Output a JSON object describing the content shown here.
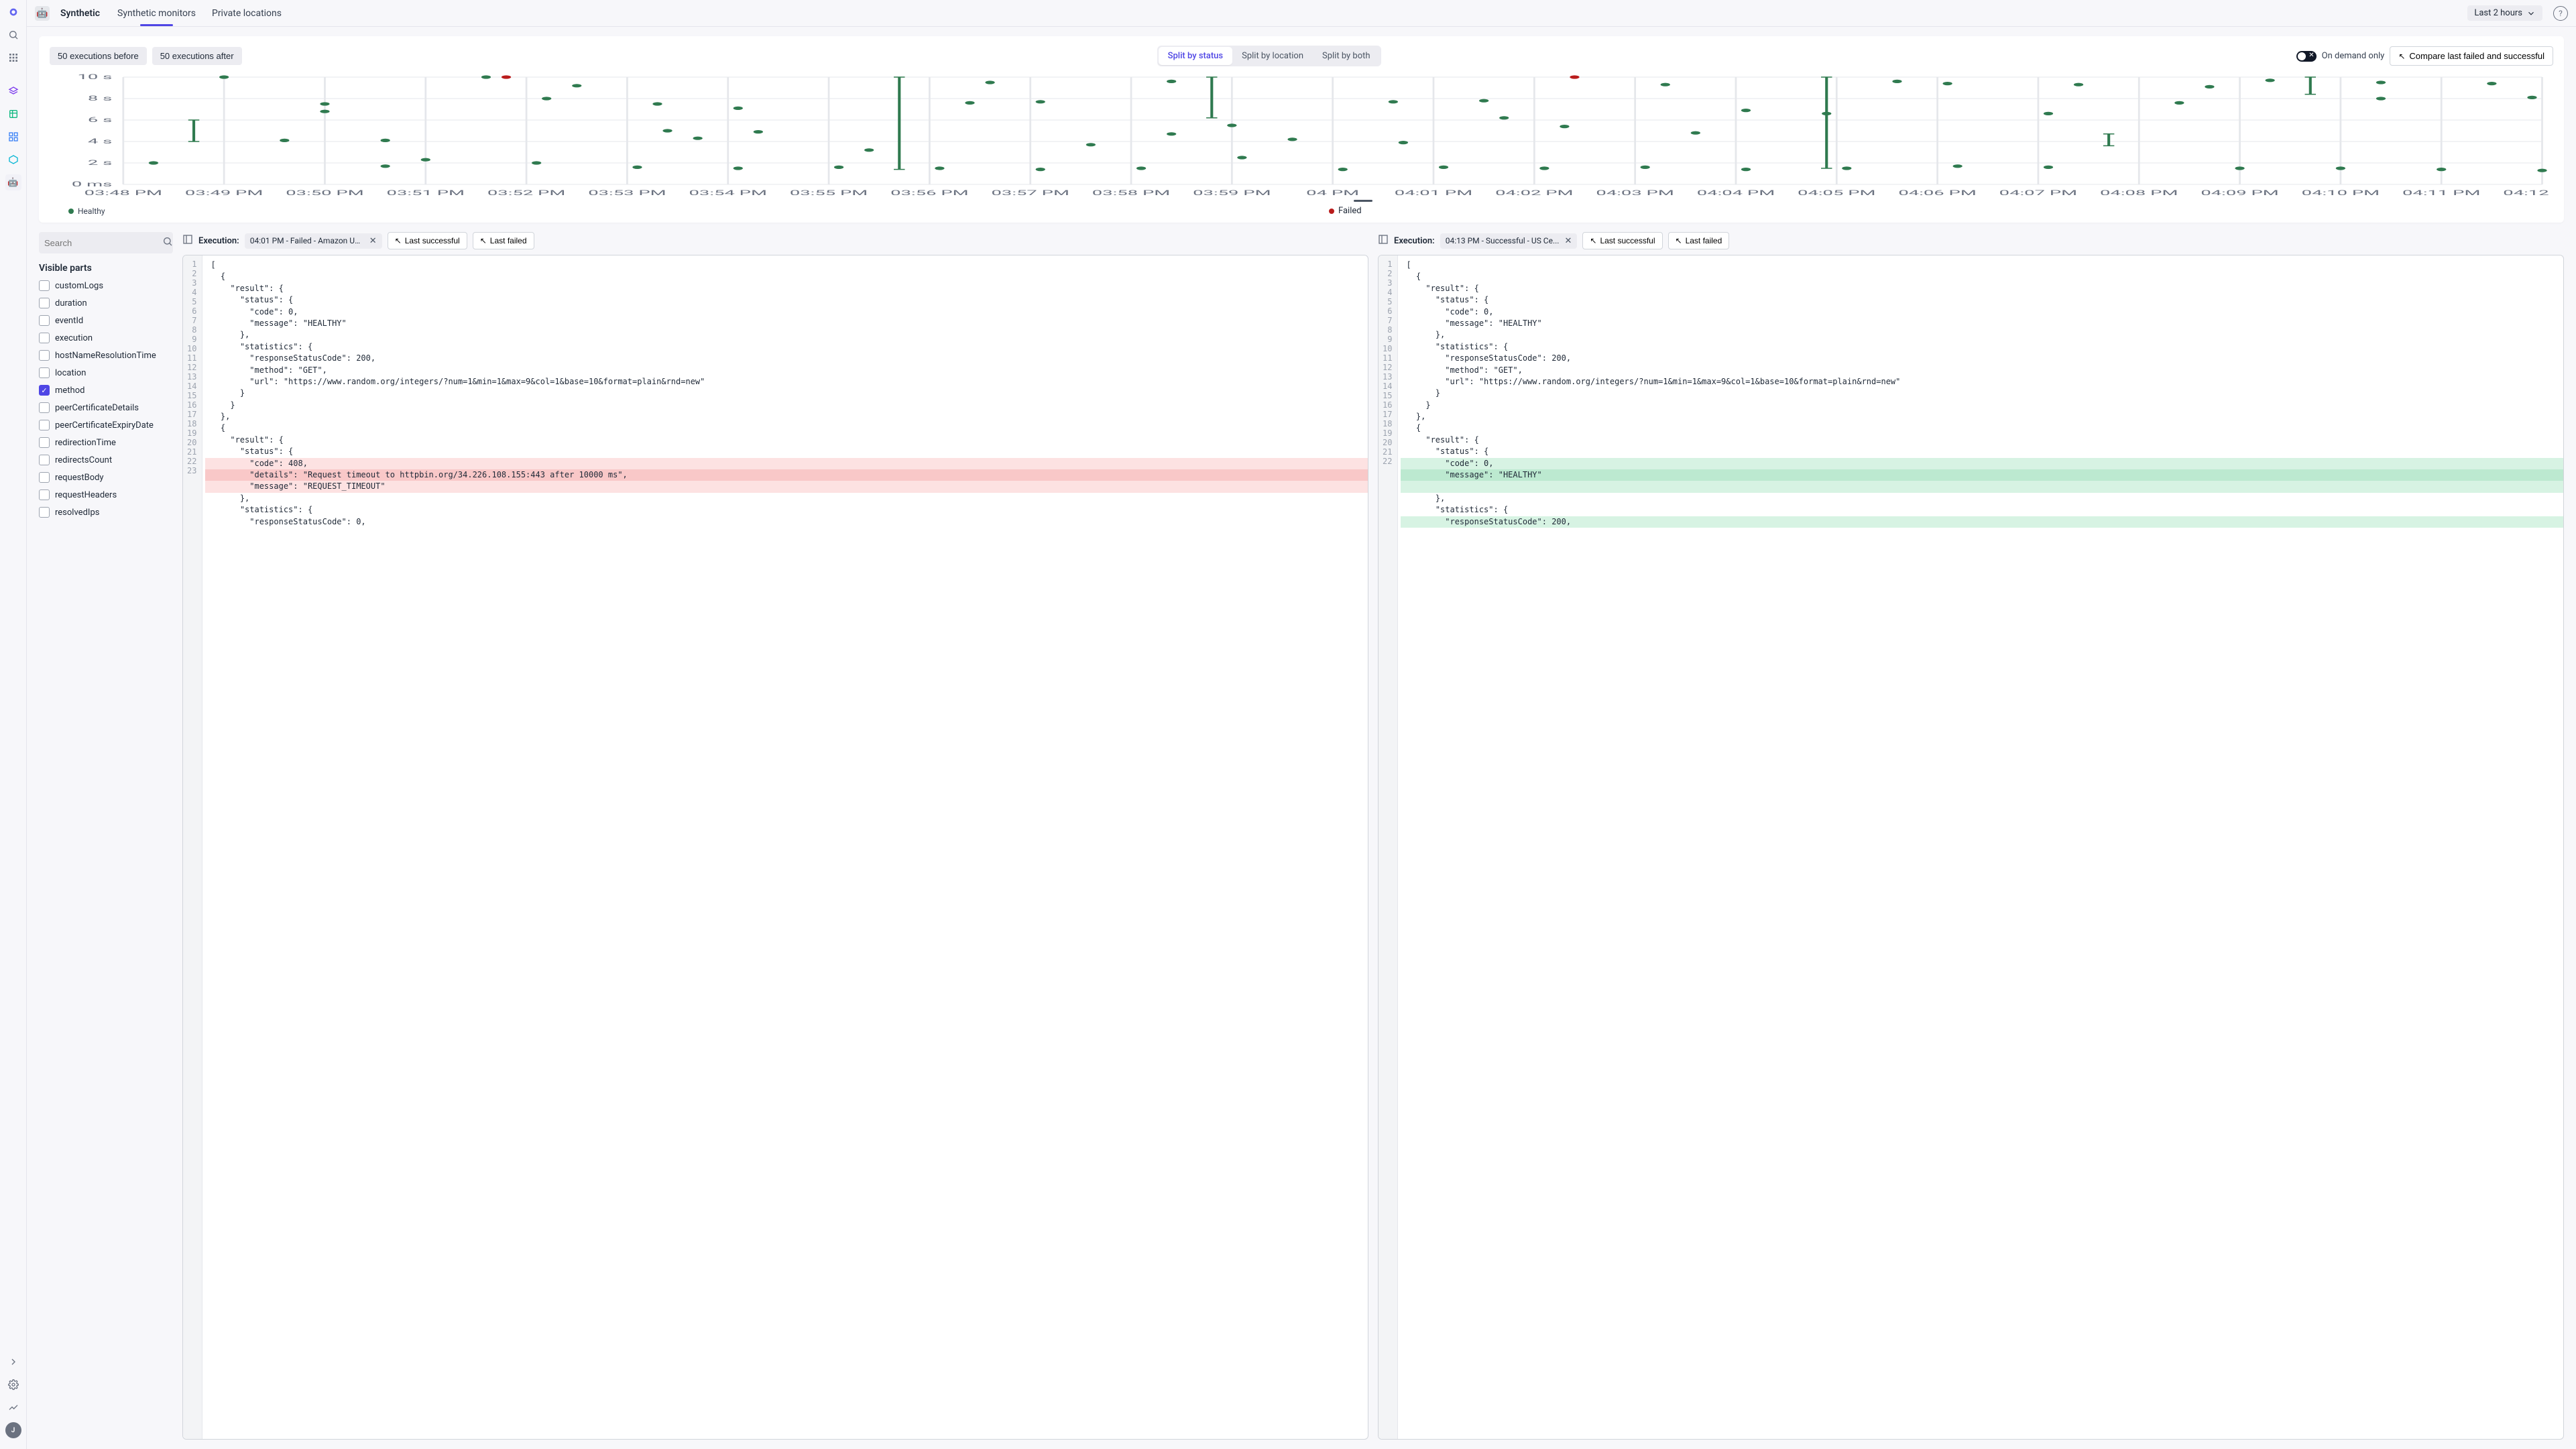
{
  "header": {
    "title": "Synthetic",
    "tabs": [
      "Synthetic monitors",
      "Private locations"
    ],
    "active_tab_index": 0,
    "time_range_label": "Last 2 hours"
  },
  "chart_toolbar": {
    "before_btn": "50 executions before",
    "after_btn": "50 executions after",
    "split_options": [
      "Split by status",
      "Split by location",
      "Split by both"
    ],
    "split_active_index": 0,
    "on_demand_label": "On demand only",
    "compare_btn": "Compare last failed and successful"
  },
  "chart_data": {
    "type": "scatter",
    "ylabel": "",
    "xlabel": "",
    "y_ticks": [
      "0 ms",
      "2 s",
      "4 s",
      "6 s",
      "8 s",
      "10 s"
    ],
    "ylim": [
      0,
      10
    ],
    "x_ticks": [
      "03:48 PM",
      "03:49 PM",
      "03:50 PM",
      "03:51 PM",
      "03:52 PM",
      "03:53 PM",
      "03:54 PM",
      "03:55 PM",
      "03:56 PM",
      "03:57 PM",
      "03:58 PM",
      "03:59 PM",
      "04 PM",
      "04:01 PM",
      "04:02 PM",
      "04:03 PM",
      "04:04 PM",
      "04:05 PM",
      "04:06 PM",
      "04:07 PM",
      "04:08 PM",
      "04:09 PM",
      "04:10 PM",
      "04:11 PM",
      "04:12 PM"
    ],
    "legend": [
      {
        "name": "Healthy",
        "color": "#2f7a4f"
      },
      {
        "name": "Failed",
        "color": "#b91c1c"
      }
    ],
    "marker_tick_x_index": 12.3,
    "series": [
      {
        "name": "Healthy",
        "points": [
          {
            "x": 0.3,
            "y": 2.0
          },
          {
            "x": 1.0,
            "y": 10.0
          },
          {
            "x": 1.6,
            "y": 4.1
          },
          {
            "x": 2.0,
            "y": 7.5
          },
          {
            "x": 2.0,
            "y": 6.8
          },
          {
            "x": 2.6,
            "y": 4.1
          },
          {
            "x": 3.0,
            "y": 2.3
          },
          {
            "x": 3.6,
            "y": 10.0
          },
          {
            "x": 4.2,
            "y": 8.0
          },
          {
            "x": 4.5,
            "y": 9.2
          },
          {
            "x": 5.3,
            "y": 7.5
          },
          {
            "x": 5.4,
            "y": 5.0
          },
          {
            "x": 5.7,
            "y": 4.3
          },
          {
            "x": 6.1,
            "y": 7.1
          },
          {
            "x": 6.3,
            "y": 4.9
          },
          {
            "x": 7.4,
            "y": 3.2
          },
          {
            "x": 8.4,
            "y": 7.6
          },
          {
            "x": 8.6,
            "y": 9.5
          },
          {
            "x": 9.1,
            "y": 7.7
          },
          {
            "x": 9.6,
            "y": 3.7
          },
          {
            "x": 10.4,
            "y": 4.7
          },
          {
            "x": 10.4,
            "y": 9.6
          },
          {
            "x": 11.0,
            "y": 5.5
          },
          {
            "x": 11.6,
            "y": 4.2
          },
          {
            "x": 12.6,
            "y": 7.7
          },
          {
            "x": 12.7,
            "y": 3.9
          },
          {
            "x": 13.5,
            "y": 7.8
          },
          {
            "x": 13.7,
            "y": 6.2
          },
          {
            "x": 14.3,
            "y": 5.4
          },
          {
            "x": 15.3,
            "y": 9.3
          },
          {
            "x": 15.6,
            "y": 4.8
          },
          {
            "x": 16.1,
            "y": 6.9
          },
          {
            "x": 16.9,
            "y": 6.6
          },
          {
            "x": 17.6,
            "y": 9.6
          },
          {
            "x": 18.1,
            "y": 9.4
          },
          {
            "x": 19.1,
            "y": 6.6
          },
          {
            "x": 19.4,
            "y": 9.3
          },
          {
            "x": 20.4,
            "y": 7.6
          },
          {
            "x": 20.7,
            "y": 9.1
          },
          {
            "x": 21.3,
            "y": 9.7
          },
          {
            "x": 22.4,
            "y": 9.5
          },
          {
            "x": 22.4,
            "y": 8.0
          },
          {
            "x": 23.5,
            "y": 9.4
          },
          {
            "x": 23.9,
            "y": 8.1
          },
          {
            "x": 24.6,
            "y": 9.1
          },
          {
            "x": 2.6,
            "y": 1.7
          },
          {
            "x": 4.1,
            "y": 2.0
          },
          {
            "x": 5.1,
            "y": 1.6
          },
          {
            "x": 6.1,
            "y": 1.5
          },
          {
            "x": 7.1,
            "y": 1.6
          },
          {
            "x": 8.1,
            "y": 1.5
          },
          {
            "x": 9.1,
            "y": 1.4
          },
          {
            "x": 10.1,
            "y": 1.5
          },
          {
            "x": 11.1,
            "y": 2.5
          },
          {
            "x": 12.1,
            "y": 1.4
          },
          {
            "x": 13.1,
            "y": 1.6
          },
          {
            "x": 14.1,
            "y": 1.5
          },
          {
            "x": 15.1,
            "y": 1.6
          },
          {
            "x": 16.1,
            "y": 1.4
          },
          {
            "x": 17.1,
            "y": 1.5
          },
          {
            "x": 18.2,
            "y": 1.7
          },
          {
            "x": 19.1,
            "y": 1.6
          },
          {
            "x": 21.0,
            "y": 1.5
          },
          {
            "x": 22.0,
            "y": 1.5
          },
          {
            "x": 23.0,
            "y": 1.4
          },
          {
            "x": 24.0,
            "y": 1.3
          }
        ]
      },
      {
        "name": "Failed",
        "points": [
          {
            "x": 3.8,
            "y": 10.6
          },
          {
            "x": 14.4,
            "y": 10.6
          }
        ]
      }
    ],
    "range_bars": [
      {
        "x": 0.7,
        "y0": 4.0,
        "y1": 6.0
      },
      {
        "x": 7.7,
        "y0": 1.4,
        "y1": 10.0
      },
      {
        "x": 10.8,
        "y0": 6.2,
        "y1": 10.0
      },
      {
        "x": 16.9,
        "y0": 1.5,
        "y1": 10.0
      },
      {
        "x": 19.7,
        "y0": 3.6,
        "y1": 4.7
      },
      {
        "x": 21.7,
        "y0": 8.4,
        "y1": 10.0
      }
    ]
  },
  "filter": {
    "search_placeholder": "Search",
    "parts_title": "Visible parts",
    "parts": [
      {
        "key": "customLogs",
        "checked": false
      },
      {
        "key": "duration",
        "checked": false
      },
      {
        "key": "eventId",
        "checked": false
      },
      {
        "key": "execution",
        "checked": false
      },
      {
        "key": "hostNameResolutionTime",
        "checked": false
      },
      {
        "key": "location",
        "checked": false
      },
      {
        "key": "method",
        "checked": true
      },
      {
        "key": "peerCertificateDetails",
        "checked": false
      },
      {
        "key": "peerCertificateExpiryDate",
        "checked": false
      },
      {
        "key": "redirectionTime",
        "checked": false
      },
      {
        "key": "redirectsCount",
        "checked": false
      },
      {
        "key": "requestBody",
        "checked": false
      },
      {
        "key": "requestHeaders",
        "checked": false
      },
      {
        "key": "resolvedIps",
        "checked": false
      }
    ]
  },
  "pane_left": {
    "label": "Execution:",
    "chip": "04:01 PM - Failed - Amazon US...",
    "btn_last_successful": "Last successful",
    "btn_last_failed": "Last failed",
    "lines": [
      {
        "n": 1,
        "t": "["
      },
      {
        "n": 2,
        "t": "  {"
      },
      {
        "n": 3,
        "t": "    \"result\": {"
      },
      {
        "n": 4,
        "t": "      \"status\": {"
      },
      {
        "n": 5,
        "t": "        \"code\": 0,"
      },
      {
        "n": 6,
        "t": "        \"message\": \"HEALTHY\""
      },
      {
        "n": 7,
        "t": "      },"
      },
      {
        "n": 8,
        "t": "      \"statistics\": {"
      },
      {
        "n": 9,
        "t": "        \"responseStatusCode\": 200,"
      },
      {
        "n": 10,
        "t": "        \"method\": \"GET\","
      },
      {
        "n": 11,
        "t": "        \"url\": \"https://www.random.org/integers/?num=1&min=1&max=9&col=1&base=10&format=plain&rnd=new\""
      },
      {
        "n": 12,
        "t": "      }"
      },
      {
        "n": 13,
        "t": "    }"
      },
      {
        "n": 14,
        "t": "  },"
      },
      {
        "n": 15,
        "t": "  {"
      },
      {
        "n": 16,
        "t": "    \"result\": {"
      },
      {
        "n": 17,
        "t": "      \"status\": {"
      },
      {
        "n": 18,
        "t": "        \"code\": 408,",
        "hl": "red"
      },
      {
        "n": 19,
        "t": "        \"details\": \"Request timeout to httpbin.org/34.226.108.155:443 after 10000 ms\",",
        "hl": "red2"
      },
      {
        "n": 20,
        "t": "        \"message\": \"REQUEST_TIMEOUT\"",
        "hl": "red"
      },
      {
        "n": 21,
        "t": "      },"
      },
      {
        "n": 22,
        "t": "      \"statistics\": {"
      },
      {
        "n": 23,
        "t": "        \"responseStatusCode\": 0,"
      }
    ]
  },
  "pane_right": {
    "label": "Execution:",
    "chip": "04:13 PM - Successful - US Ce...",
    "btn_last_successful": "Last successful",
    "btn_last_failed": "Last failed",
    "lines": [
      {
        "n": 1,
        "t": "["
      },
      {
        "n": 2,
        "t": "  {"
      },
      {
        "n": 3,
        "t": "    \"result\": {"
      },
      {
        "n": 4,
        "t": "      \"status\": {"
      },
      {
        "n": 5,
        "t": "        \"code\": 0,"
      },
      {
        "n": 6,
        "t": "        \"message\": \"HEALTHY\""
      },
      {
        "n": 7,
        "t": "      },"
      },
      {
        "n": 8,
        "t": "      \"statistics\": {"
      },
      {
        "n": 9,
        "t": "        \"responseStatusCode\": 200,"
      },
      {
        "n": 10,
        "t": "        \"method\": \"GET\","
      },
      {
        "n": 11,
        "t": "        \"url\": \"https://www.random.org/integers/?num=1&min=1&max=9&col=1&base=10&format=plain&rnd=new\""
      },
      {
        "n": 12,
        "t": "      }"
      },
      {
        "n": 13,
        "t": "    }"
      },
      {
        "n": 14,
        "t": "  },"
      },
      {
        "n": 15,
        "t": "  {"
      },
      {
        "n": 16,
        "t": "    \"result\": {"
      },
      {
        "n": 17,
        "t": "      \"status\": {"
      },
      {
        "n": 18,
        "t": "        \"code\": 0,",
        "hl": "green"
      },
      {
        "n": 19,
        "t": "        \"message\": \"HEALTHY\"",
        "hl": "green2"
      },
      {
        "n": "",
        "t": "",
        "hl": "green"
      },
      {
        "n": 20,
        "t": "      },"
      },
      {
        "n": 21,
        "t": "      \"statistics\": {"
      },
      {
        "n": 22,
        "t": "        \"responseStatusCode\": 200,",
        "hl": "green"
      }
    ]
  }
}
